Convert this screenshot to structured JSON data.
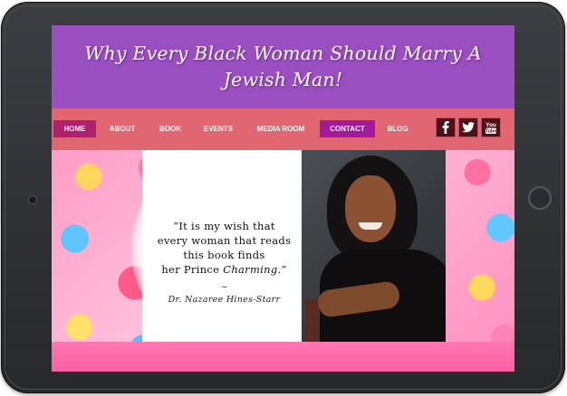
{
  "site": {
    "title": "Why Every Black Woman Should Marry A Jewish Man!"
  },
  "nav": {
    "items": [
      {
        "label": "HOME",
        "active": true
      },
      {
        "label": "ABOUT"
      },
      {
        "label": "BOOK"
      },
      {
        "label": "EVENTS"
      },
      {
        "label": "MEDIA ROOM"
      },
      {
        "label": "CONTACT",
        "highlighted": true
      },
      {
        "label": "BLOG"
      }
    ],
    "social": [
      {
        "name": "facebook",
        "icon": "facebook-icon"
      },
      {
        "name": "twitter",
        "icon": "twitter-icon"
      },
      {
        "name": "youtube",
        "icon": "youtube-icon"
      }
    ]
  },
  "hero": {
    "quote_line1": "“It is my wish that",
    "quote_line2": "every woman that reads",
    "quote_line3": "this book finds",
    "quote_line4_pre": "her Prince ",
    "quote_line4_em": "Charming",
    "quote_line4_post": ".”",
    "dash": "~",
    "author": "Dr. Nazaree Hines-Starr"
  },
  "colors": {
    "header": "#9a4fc1",
    "navbar": "#e06671",
    "nav_active": "#b0206f",
    "nav_contact": "#a3199a",
    "social_bg": "#4d1018"
  }
}
